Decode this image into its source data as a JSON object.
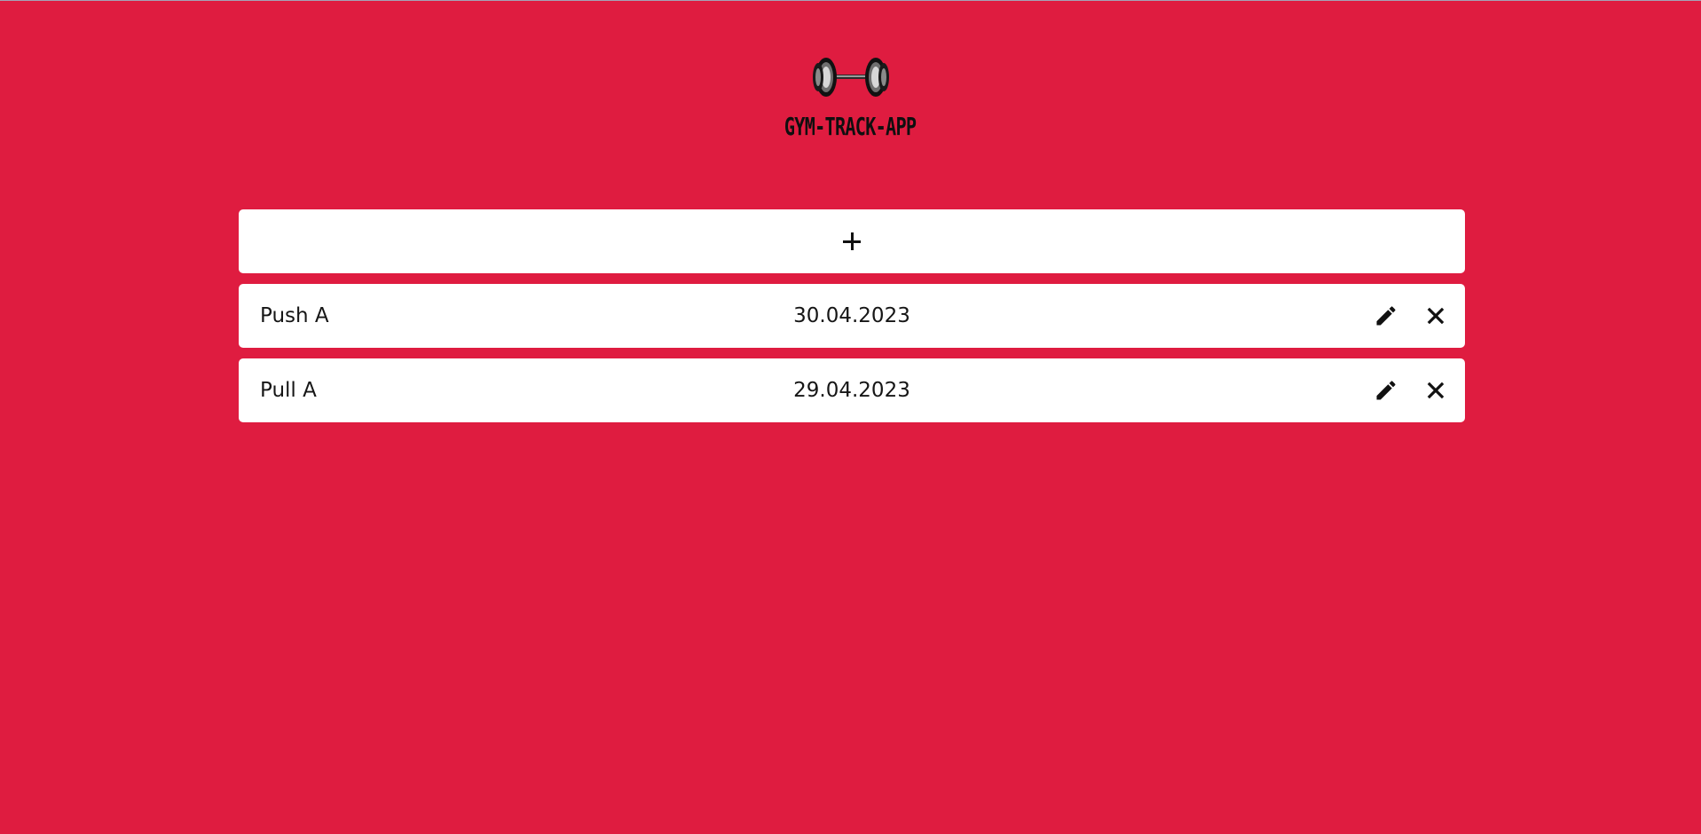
{
  "app": {
    "title": "GYM-TRACK-APP",
    "logo_icon": "dumbbell-icon",
    "background_color": "#df1c40"
  },
  "add_button": {
    "label": "+",
    "icon": "plus-icon"
  },
  "workouts": [
    {
      "name": "Push A",
      "date": "30.04.2023",
      "edit_icon": "pencil-icon",
      "delete_icon": "close-icon"
    },
    {
      "name": "Pull A",
      "date": "29.04.2023",
      "edit_icon": "pencil-icon",
      "delete_icon": "close-icon"
    }
  ]
}
